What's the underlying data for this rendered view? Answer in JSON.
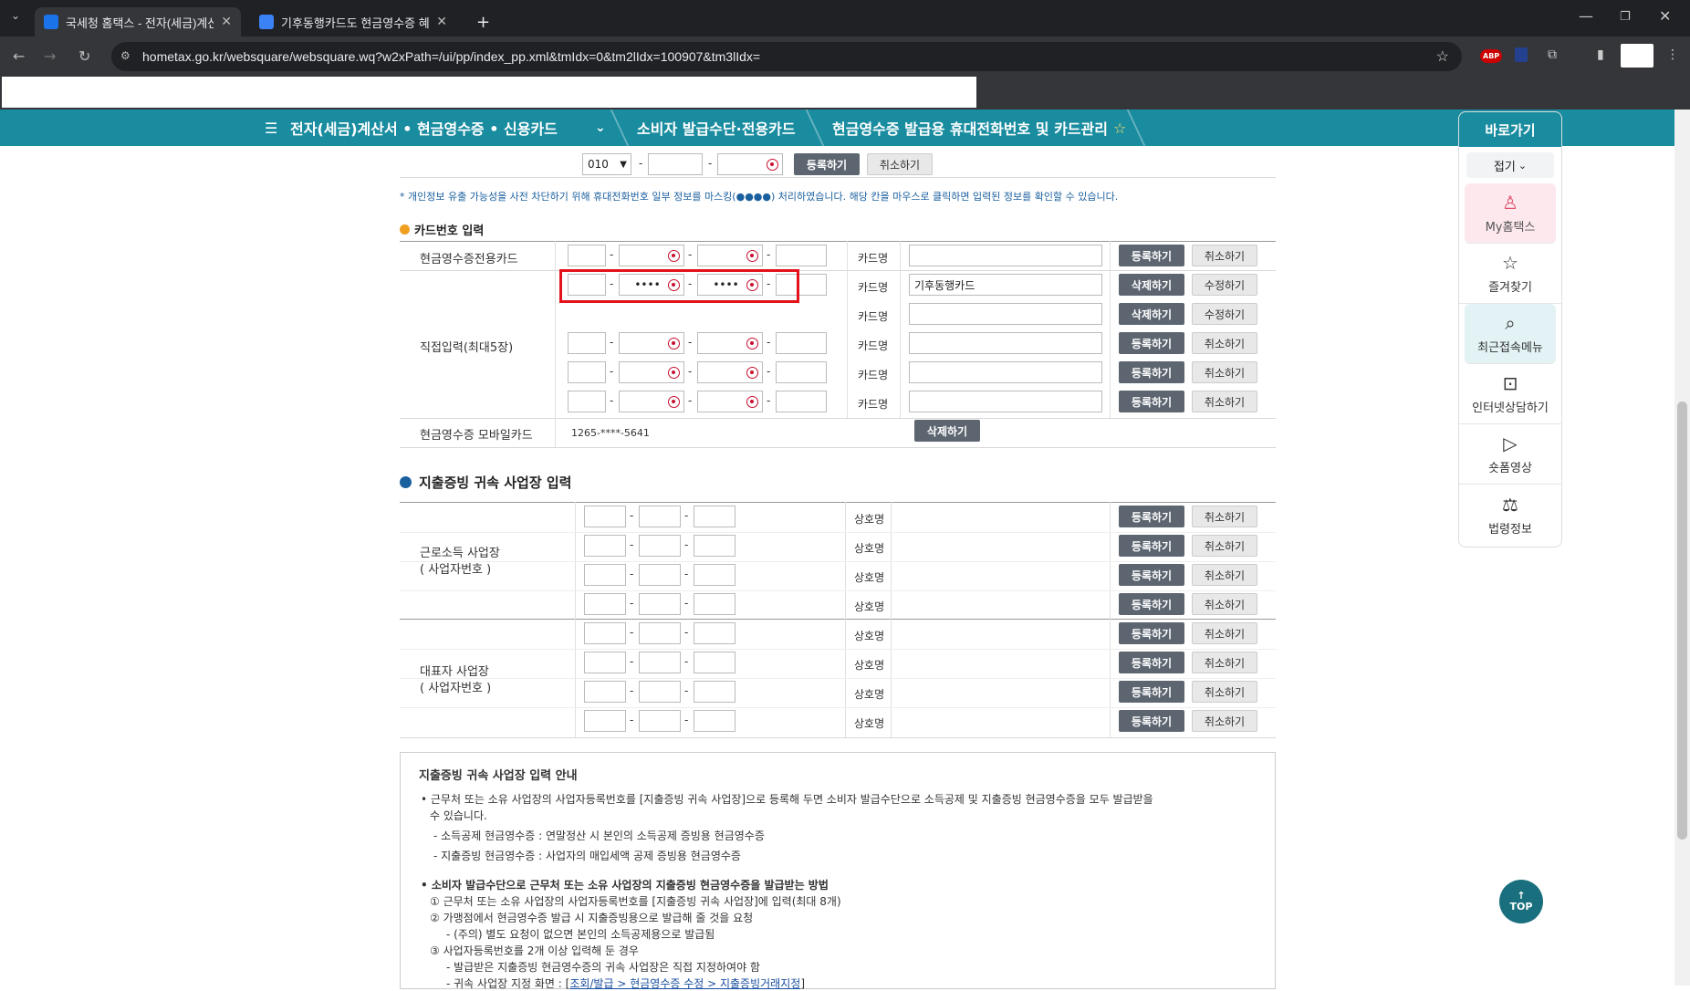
{
  "browser": {
    "tabs": [
      {
        "title": "국세청 홈택스 - 전자(세금)계산",
        "icon_color": "#1a73e8",
        "active": true
      },
      {
        "title": "기후동행카드도 현금영수증 혜",
        "icon_color": "#3b82f6",
        "active": false
      }
    ],
    "url": "hometax.go.kr/websquare/websquare.wq?w2xPath=/ui/pp/index_pp.xml&tmIdx=0&tm2lIdx=100907&tm3lIdx=",
    "new_tab": "+",
    "ext_abp": "ABP"
  },
  "menu": {
    "hamburger": "☰",
    "crumb1": "전자(세금)계산서 • 현금영수증 • 신용카드",
    "crumb2": "소비자 발급수단·전용카드",
    "crumb3": "현금영수증 발급용 휴대전화번호 및 카드관리",
    "star": "☆"
  },
  "quick": {
    "title": "바로가기",
    "fold": "접기",
    "items": [
      {
        "label": "My홈택스",
        "icon": "person-icon"
      },
      {
        "label": "즐겨찾기",
        "icon": "star-icon"
      },
      {
        "label": "최근접속메뉴",
        "icon": "recent-icon"
      },
      {
        "label": "인터넷상담하기",
        "icon": "laptop-icon"
      },
      {
        "label": "숏폼영상",
        "icon": "play-icon"
      },
      {
        "label": "법령정보",
        "icon": "gavel-icon"
      }
    ]
  },
  "top_button": {
    "arrow": "↑",
    "label": "TOP"
  },
  "phone": {
    "prefix": "010",
    "register": "등록하기",
    "cancel": "취소하기"
  },
  "mask_note": "* 개인정보 유출 가능성을 사전 차단하기 위해 휴대전화번호 일부 정보를 마스킹(●●●●) 처리하였습니다. 해당 칸을 마우스로 클릭하면 입력된 정보를 확인할 수 있습니다.",
  "card_section": {
    "title": "카드번호 입력",
    "dedicated_label": "현금영수증전용카드",
    "direct_label": "직접입력(최대5장)",
    "mobile_label": "현금영수증 모바일카드",
    "mobile_number": "1265-****-5641",
    "card_name_label": "카드명",
    "masked": "••••",
    "saved_card_name": "기후동행카드",
    "btn_register": "등록하기",
    "btn_cancel": "취소하기",
    "btn_delete": "삭제하기",
    "btn_edit": "수정하기"
  },
  "biz_section": {
    "title": "지출증빙 귀속 사업장 입력",
    "work_label_1": "근로소득 사업장",
    "work_label_2": "( 사업자번호 )",
    "rep_label_1": "대표자 사업장",
    "rep_label_2": "( 사업자번호 )",
    "name_label": "상호명"
  },
  "guide": {
    "title": "지출증빙 귀속 사업장 입력 안내",
    "l1": "• 근무처 또는 소유 사업장의 사업자등록번호를 [지출증빙 귀속 사업장]으로 등록해 두면 소비자 발급수단으로 소득공제 및 지출증빙 현금영수증을 모두 발급받을",
    "l1b": "수 있습니다.",
    "l2": "- 소득공제 현금영수증 : 연말정산 시 본인의 소득공제 증빙용 현금영수증",
    "l3": "- 지출증빙 현금영수증 : 사업자의 매입세액 공제 증빙용 현금영수증",
    "l4": "• 소비자 발급수단으로 근무처 또는 소유 사업장의 지출증빙 현금영수증을 발급받는 방법",
    "l5": "① 근무처 또는 소유 사업장의 사업자등록번호를 [지출증빙 귀속 사업장]에 입력(최대 8개)",
    "l6": "② 가맹점에서 현금영수증 발급 시 지출증빙용으로 발급해 줄 것을 요청",
    "l7": "- (주의) 별도 요청이 없으면 본인의 소득공제용으로 발급됨",
    "l8": "③ 사업자등록번호를 2개 이상 입력해 둔 경우",
    "l9": "- 발급받은 지출증빙 현금영수증의 귀속 사업장은 직접 지정하여야 함",
    "l10a": "- 귀속 사업장 지정 화면 : [",
    "l10link": "조회/발급 > 현금영수증 수정 > 지출증빙거래지정",
    "l10b": "]"
  }
}
